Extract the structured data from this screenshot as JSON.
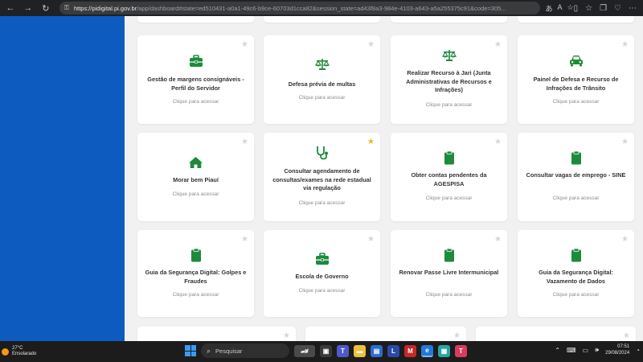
{
  "browser": {
    "url_host": "https://pidigital.pi.gov.br",
    "url_rest": "/app/dashboard#state=ed510431-a0a1-49c6-b9ce-60703d1cca82&session_state=ad43f8a3-984e-4103-a643-a5a255375c91&code=305..."
  },
  "colors": {
    "accent_green": "#1f8a3d",
    "panel_blue": "#0d5bbf",
    "star_active": "#f2b71d"
  },
  "cards": [
    {
      "title": "Gestão de margens consignáveis - Perfil do Servidor",
      "cta": "Clique para acessar",
      "icon": "briefcase-icon",
      "favorite": false
    },
    {
      "title": "Defesa prévia de multas",
      "cta": "Clique para acessar",
      "icon": "scales-icon",
      "favorite": false
    },
    {
      "title": "Realizar Recurso à Jari (Junta Administrativas de Recursos e Infrações)",
      "cta": "Clique para acessar",
      "icon": "scales-icon",
      "favorite": false
    },
    {
      "title": "Painel de Defesa e Recurso de Infrações de Trânsito",
      "cta": "Clique para acessar",
      "icon": "car-icon",
      "favorite": false
    },
    {
      "title": "Morar bem Piauí",
      "cta": "Clique para acessar",
      "icon": "house-icon",
      "favorite": false
    },
    {
      "title": "Consultar agendamento de consultas/exames na rede estadual via regulação",
      "cta": "Clique para acessar",
      "icon": "stethoscope-icon",
      "favorite": true
    },
    {
      "title": "Obter contas pendentes da AGESPISA",
      "cta": "Clique para acessar",
      "icon": "clipboard-icon",
      "favorite": false
    },
    {
      "title": "Consultar vagas de emprego - SINE",
      "cta": "Clique para acessar",
      "icon": "clipboard-icon",
      "favorite": false
    },
    {
      "title": "Guia da Segurança Digital: Golpes e Fraudes",
      "cta": "Clique para acessar",
      "icon": "clipboard-icon",
      "favorite": false
    },
    {
      "title": "Escola de Governo",
      "cta": "Clique para acessar",
      "icon": "briefcase-icon",
      "favorite": false
    },
    {
      "title": "Renovar Passe Livre Intermunicipal",
      "cta": "Clique para acessar",
      "icon": "clipboard-icon",
      "favorite": false
    },
    {
      "title": "Guia da Segurança Digital: Vazamento de Dados",
      "cta": "Clique para acessar",
      "icon": "clipboard-icon",
      "favorite": false
    }
  ],
  "taskbar": {
    "temperature": "27°C",
    "condition": "Ensolarado",
    "search_placeholder": "Pesquisar",
    "time": "07:51",
    "date": "29/08/2024"
  }
}
